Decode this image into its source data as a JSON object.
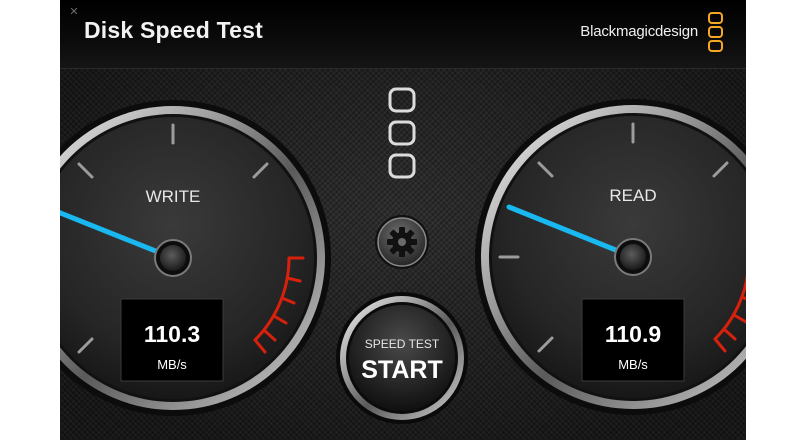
{
  "window": {
    "title": "Disk Speed Test",
    "brand": "Blackmagicdesign",
    "close_icon": "close-icon"
  },
  "gauges": {
    "write": {
      "label": "WRITE",
      "value": "110.3",
      "unit": "MB/s"
    },
    "read": {
      "label": "READ",
      "value": "110.9",
      "unit": "MB/s"
    }
  },
  "controls": {
    "settings_icon": "gear-icon",
    "start_top_label": "SPEED TEST",
    "start_label": "START"
  },
  "colors": {
    "needle": "#19b8f0",
    "redline": "#d8210c",
    "brand_accent": "#f5a623"
  }
}
